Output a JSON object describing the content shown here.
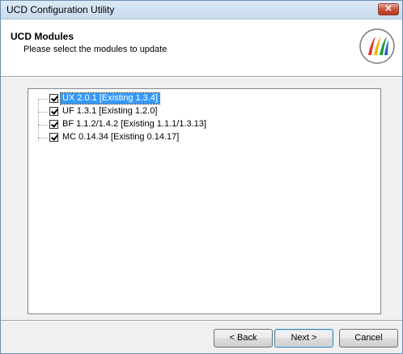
{
  "window": {
    "title": "UCD Configuration Utility",
    "close_glyph": "✕"
  },
  "header": {
    "title": "UCD Modules",
    "subtitle": "Please select the modules to update",
    "logo_icon": "ucd-logo-icon"
  },
  "modules": [
    {
      "label": "UX 2.0.1 [Existing 1.3.4]",
      "checked": true,
      "selected": true
    },
    {
      "label": "UF 1.3.1 [Existing 1.2.0]",
      "checked": true,
      "selected": false
    },
    {
      "label": "BF 1.1.2/1.4.2 [Existing 1.1.1/1.3.13]",
      "checked": true,
      "selected": false
    },
    {
      "label": "MC 0.14.34 [Existing 0.14.17]",
      "checked": true,
      "selected": false
    }
  ],
  "buttons": {
    "back": "< Back",
    "next": "Next >",
    "cancel": "Cancel"
  },
  "colors": {
    "selection": "#3399ff",
    "close": "#c8523f"
  }
}
